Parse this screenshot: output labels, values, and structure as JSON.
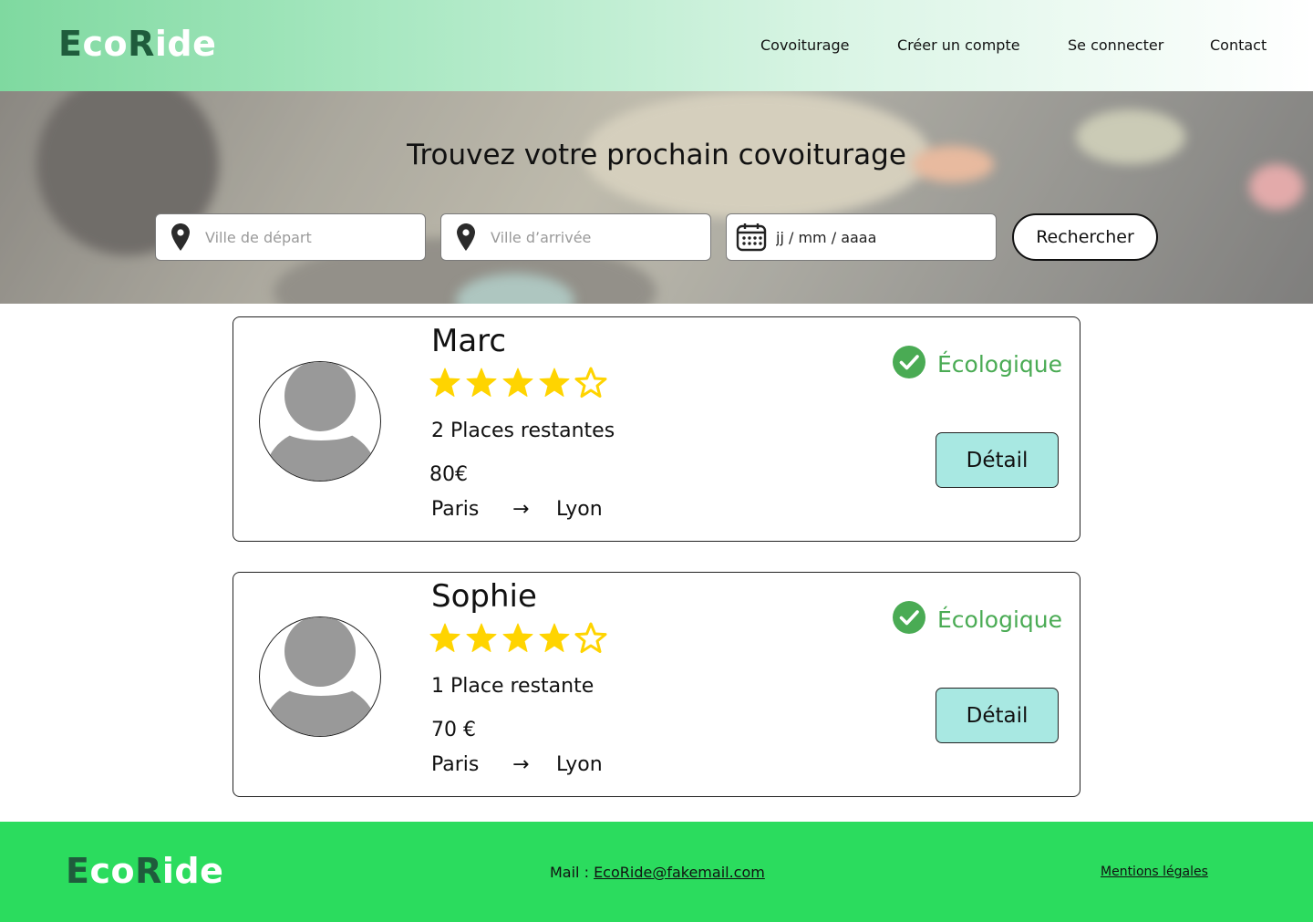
{
  "brand": {
    "logo_part1": "E",
    "logo_part2": "co",
    "logo_part3": "R",
    "logo_part4": "ide"
  },
  "nav": {
    "items": [
      {
        "label": "Covoiturage"
      },
      {
        "label": "Créer un compte"
      },
      {
        "label": "Se connecter"
      },
      {
        "label": "Contact"
      }
    ]
  },
  "hero": {
    "title": "Trouvez votre prochain covoiturage",
    "departure_placeholder": "Ville de départ",
    "arrival_placeholder": "Ville d’arrivée",
    "date_placeholder": "jj / mm / aaaa",
    "search_label": "Rechercher"
  },
  "rides": [
    {
      "driver": "Marc",
      "rating": 4,
      "rating_max": 5,
      "seats": "2 Places restantes",
      "price": "80€",
      "from": "Paris",
      "arrow": "→",
      "to": "Lyon",
      "eco_label": "Écologique",
      "detail_label": "Détail"
    },
    {
      "driver": "Sophie",
      "rating": 4,
      "rating_max": 5,
      "seats": "1 Place restante",
      "price": "70 €",
      "from": "Paris",
      "arrow": "→",
      "to": "Lyon",
      "eco_label": "Écologique",
      "detail_label": "Détail"
    }
  ],
  "footer": {
    "mail_label": "Mail : ",
    "mail_address": "EcoRide@fakemail.com",
    "legal": "Mentions légales"
  },
  "colors": {
    "brand_dark": "#1f5c3c",
    "footer_green": "#2bdc5e",
    "eco_green": "#4aab54",
    "star_yellow": "#ffd400",
    "detail_button": "#a8e8e2"
  },
  "icons": {
    "location": "map-pin-icon",
    "date": "calendar-icon",
    "eco": "check-circle-icon",
    "star": "star-icon"
  }
}
